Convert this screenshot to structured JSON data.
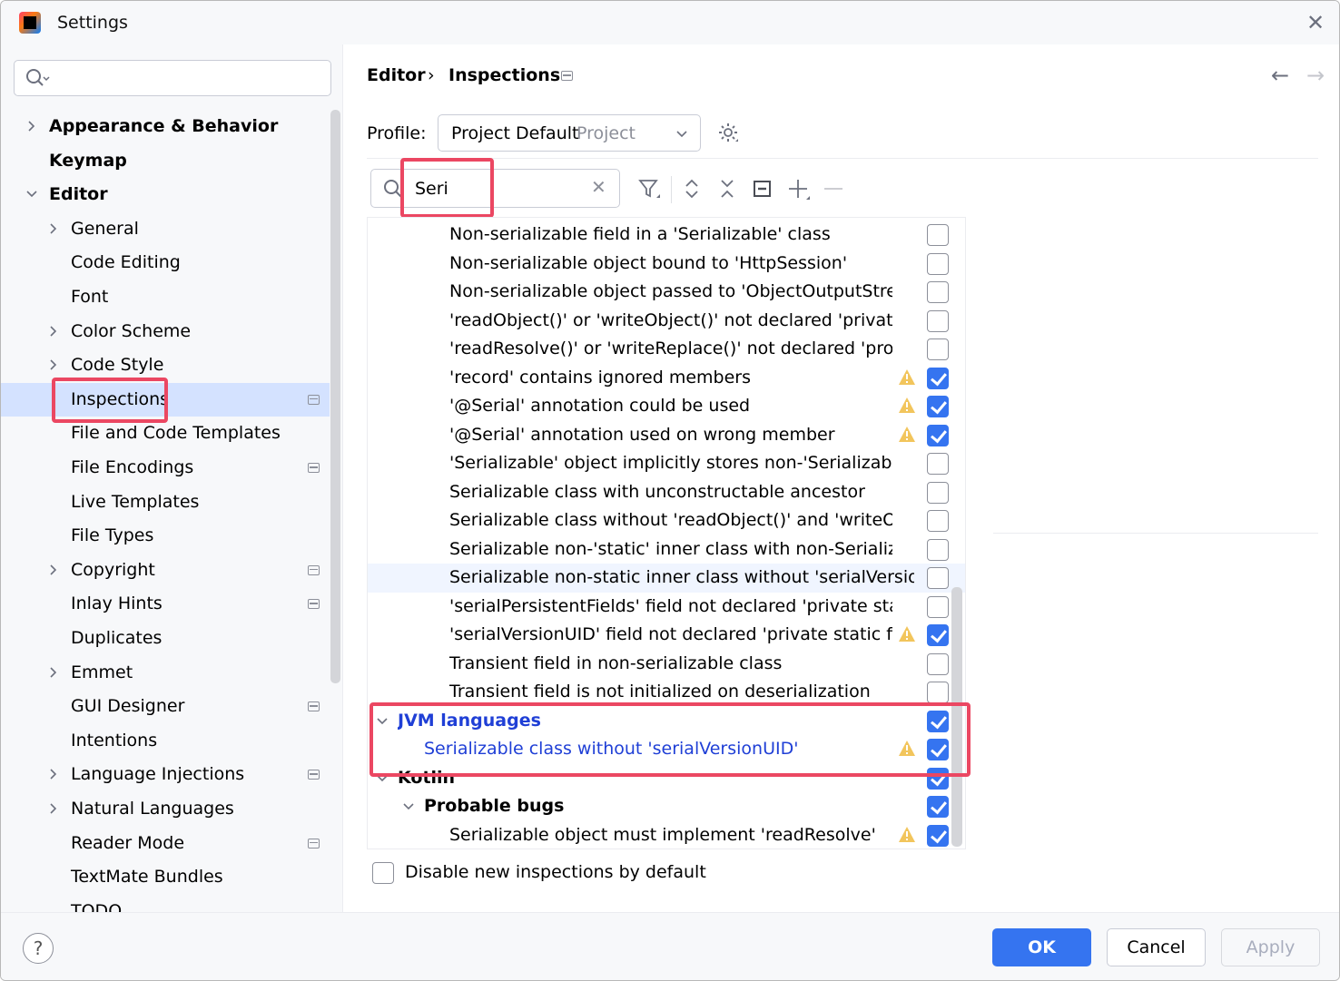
{
  "window": {
    "title": "Settings",
    "app_icon": "intellij-idea-icon"
  },
  "sidebar": {
    "search": {
      "value": "",
      "placeholder": ""
    },
    "items": [
      {
        "label": "Appearance & Behavior",
        "level": 0,
        "expandable": true,
        "expanded": false,
        "bold": true
      },
      {
        "label": "Keymap",
        "level": 0,
        "expandable": false,
        "bold": true
      },
      {
        "label": "Editor",
        "level": 0,
        "expandable": true,
        "expanded": true,
        "bold": true
      },
      {
        "label": "General",
        "level": 1,
        "expandable": true,
        "expanded": false
      },
      {
        "label": "Code Editing",
        "level": 1,
        "expandable": false
      },
      {
        "label": "Font",
        "level": 1,
        "expandable": false
      },
      {
        "label": "Color Scheme",
        "level": 1,
        "expandable": true,
        "expanded": false
      },
      {
        "label": "Code Style",
        "level": 1,
        "expandable": true,
        "expanded": false
      },
      {
        "label": "Inspections",
        "level": 1,
        "expandable": false,
        "selected": true,
        "project_icon": true
      },
      {
        "label": "File and Code Templates",
        "level": 1,
        "expandable": false
      },
      {
        "label": "File Encodings",
        "level": 1,
        "expandable": false,
        "project_icon": true
      },
      {
        "label": "Live Templates",
        "level": 1,
        "expandable": false
      },
      {
        "label": "File Types",
        "level": 1,
        "expandable": false
      },
      {
        "label": "Copyright",
        "level": 1,
        "expandable": true,
        "expanded": false,
        "project_icon": true
      },
      {
        "label": "Inlay Hints",
        "level": 1,
        "expandable": false,
        "project_icon": true
      },
      {
        "label": "Duplicates",
        "level": 1,
        "expandable": false
      },
      {
        "label": "Emmet",
        "level": 1,
        "expandable": true,
        "expanded": false
      },
      {
        "label": "GUI Designer",
        "level": 1,
        "expandable": false,
        "project_icon": true
      },
      {
        "label": "Intentions",
        "level": 1,
        "expandable": false
      },
      {
        "label": "Language Injections",
        "level": 1,
        "expandable": true,
        "expanded": false,
        "project_icon": true
      },
      {
        "label": "Natural Languages",
        "level": 1,
        "expandable": true,
        "expanded": false
      },
      {
        "label": "Reader Mode",
        "level": 1,
        "expandable": false,
        "project_icon": true
      },
      {
        "label": "TextMate Bundles",
        "level": 1,
        "expandable": false
      },
      {
        "label": "TODO",
        "level": 1,
        "expandable": false
      }
    ]
  },
  "breadcrumb": {
    "parent": "Editor",
    "separator": "›",
    "current": "Inspections"
  },
  "profile": {
    "label": "Profile:",
    "value": "Project Default",
    "scope": "Project"
  },
  "filter": {
    "value": "Seri",
    "placeholder": ""
  },
  "inspections": [
    {
      "label": "Non-serializable field in a 'Serializable' class",
      "level": 3,
      "checked": false,
      "warning": false
    },
    {
      "label": "Non-serializable object bound to 'HttpSession'",
      "level": 3,
      "checked": false,
      "warning": false
    },
    {
      "label": "Non-serializable object passed to 'ObjectOutputStream'",
      "level": 3,
      "checked": false,
      "warning": false
    },
    {
      "label": "'readObject()' or 'writeObject()' not declared 'private'",
      "level": 3,
      "checked": false,
      "warning": false
    },
    {
      "label": "'readResolve()' or 'writeReplace()' not declared 'protected'",
      "level": 3,
      "checked": false,
      "warning": false
    },
    {
      "label": "'record' contains ignored members",
      "level": 3,
      "checked": true,
      "warning": true
    },
    {
      "label": "'@Serial' annotation could be used",
      "level": 3,
      "checked": true,
      "warning": true
    },
    {
      "label": "'@Serial' annotation used on wrong member",
      "level": 3,
      "checked": true,
      "warning": true
    },
    {
      "label": "'Serializable' object implicitly stores non-'Serializable' objects",
      "level": 3,
      "checked": false,
      "warning": false
    },
    {
      "label": "Serializable class with unconstructable ancestor",
      "level": 3,
      "checked": false,
      "warning": false
    },
    {
      "label": "Serializable class without 'readObject()' and 'writeObject()'",
      "level": 3,
      "checked": false,
      "warning": false
    },
    {
      "label": "Serializable non-'static' inner class with non-Serializable outer class",
      "level": 3,
      "checked": false,
      "warning": false
    },
    {
      "label": "Serializable non-static inner class without 'serialVersionUID'",
      "level": 3,
      "checked": false,
      "warning": false,
      "hover": true
    },
    {
      "label": "'serialPersistentFields' field not declared 'private static final'",
      "level": 3,
      "checked": false,
      "warning": false
    },
    {
      "label": "'serialVersionUID' field not declared 'private static final long'",
      "level": 3,
      "checked": true,
      "warning": true
    },
    {
      "label": "Transient field in non-serializable class",
      "level": 3,
      "checked": false,
      "warning": false
    },
    {
      "label": "Transient field is not initialized on deserialization",
      "level": 3,
      "checked": false,
      "warning": false
    },
    {
      "label": "JVM languages",
      "level": 1,
      "checked": true,
      "warning": false,
      "group": true,
      "expanded": true,
      "modified": true
    },
    {
      "label": "Serializable class without 'serialVersionUID'",
      "level": 2,
      "checked": true,
      "warning": true,
      "modified": true
    },
    {
      "label": "Kotlin",
      "level": 1,
      "checked": true,
      "warning": false,
      "group": true,
      "expanded": true
    },
    {
      "label": "Probable bugs",
      "level": 2,
      "checked": true,
      "warning": false,
      "group": true,
      "expanded": true
    },
    {
      "label": "Serializable object must implement 'readResolve'",
      "level": 3,
      "checked": true,
      "warning": true
    }
  ],
  "disable_new": {
    "label": "Disable new inspections by default",
    "checked": false
  },
  "buttons": {
    "ok": "OK",
    "cancel": "Cancel",
    "apply": "Apply",
    "help": "?"
  },
  "colors": {
    "accent": "#3574f0",
    "selection": "#d4e2ff",
    "highlight_box": "#eb4762",
    "modified_text": "#1f3fd6",
    "warning": "#f2c55c"
  }
}
